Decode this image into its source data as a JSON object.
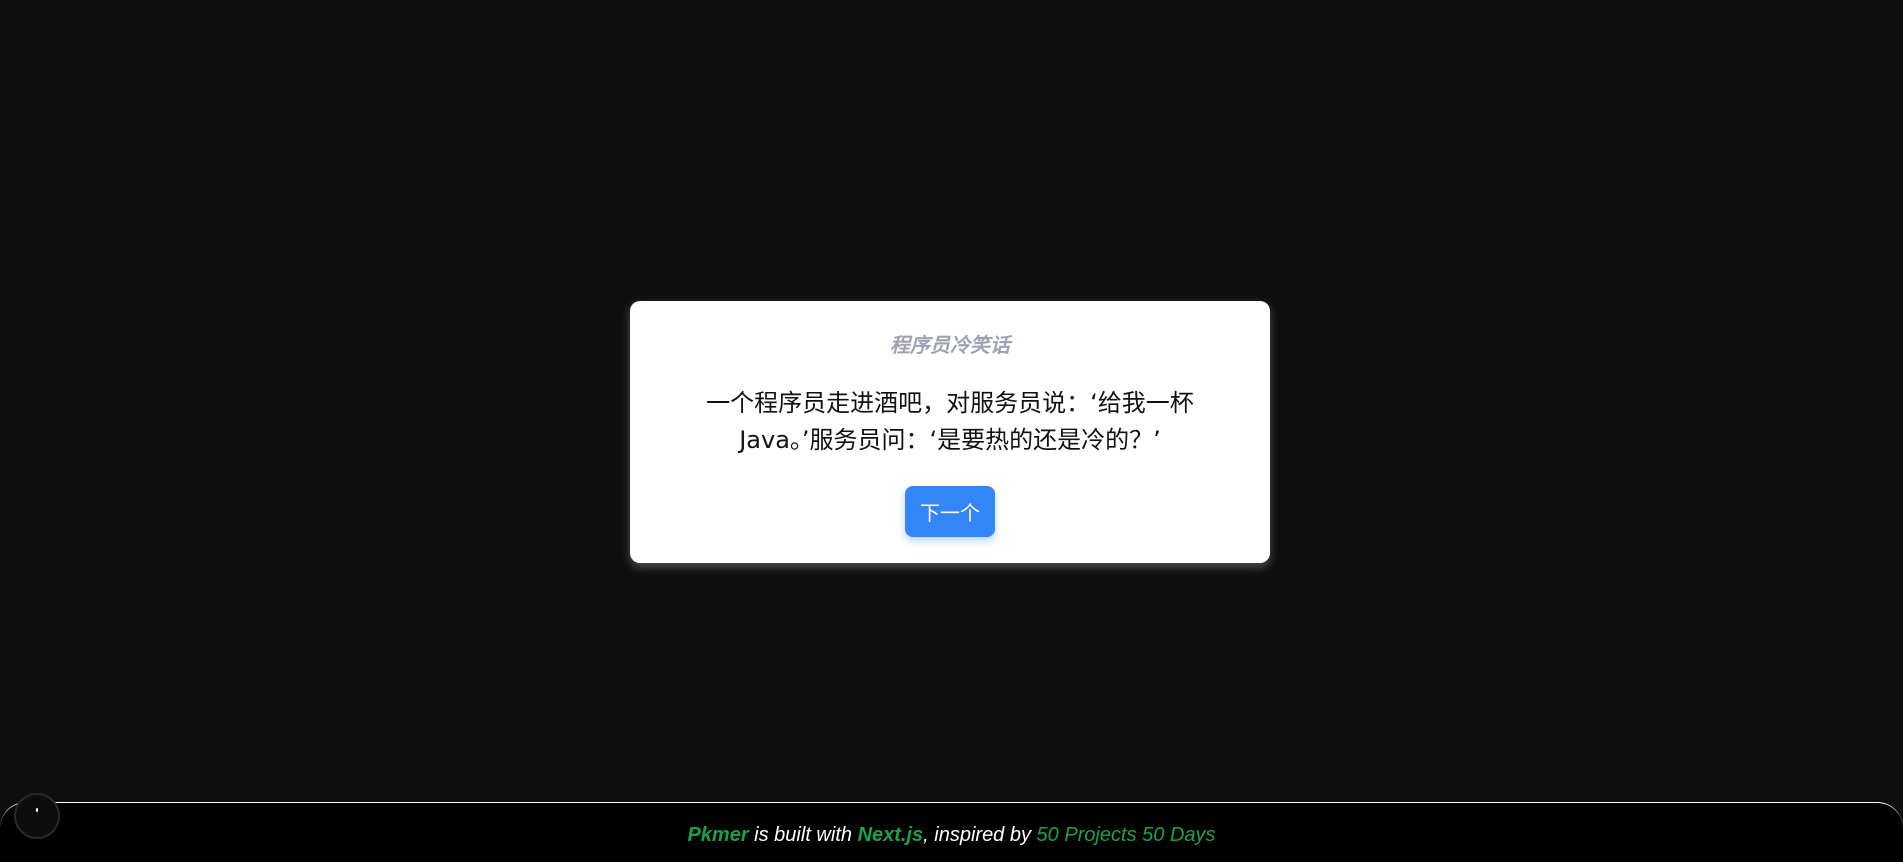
{
  "card": {
    "title": "程序员冷笑话",
    "joke": "一个程序员走进酒吧，对服务员说：‘给我一杯 Java。’服务员问：‘是要热的还是冷的？’",
    "next_button_label": "下一个"
  },
  "footer": {
    "brand": "Pkmer",
    "built_with": " is built with ",
    "framework": "Next.js",
    "inspired_by": ", inspired by ",
    "inspiration": "50 Projects 50 Days"
  },
  "colors": {
    "background": "#0e0e0e",
    "card": "#ffffff",
    "button": "#3485f7",
    "accent_green": "#16a34a",
    "title_gray": "#9ca3af"
  }
}
